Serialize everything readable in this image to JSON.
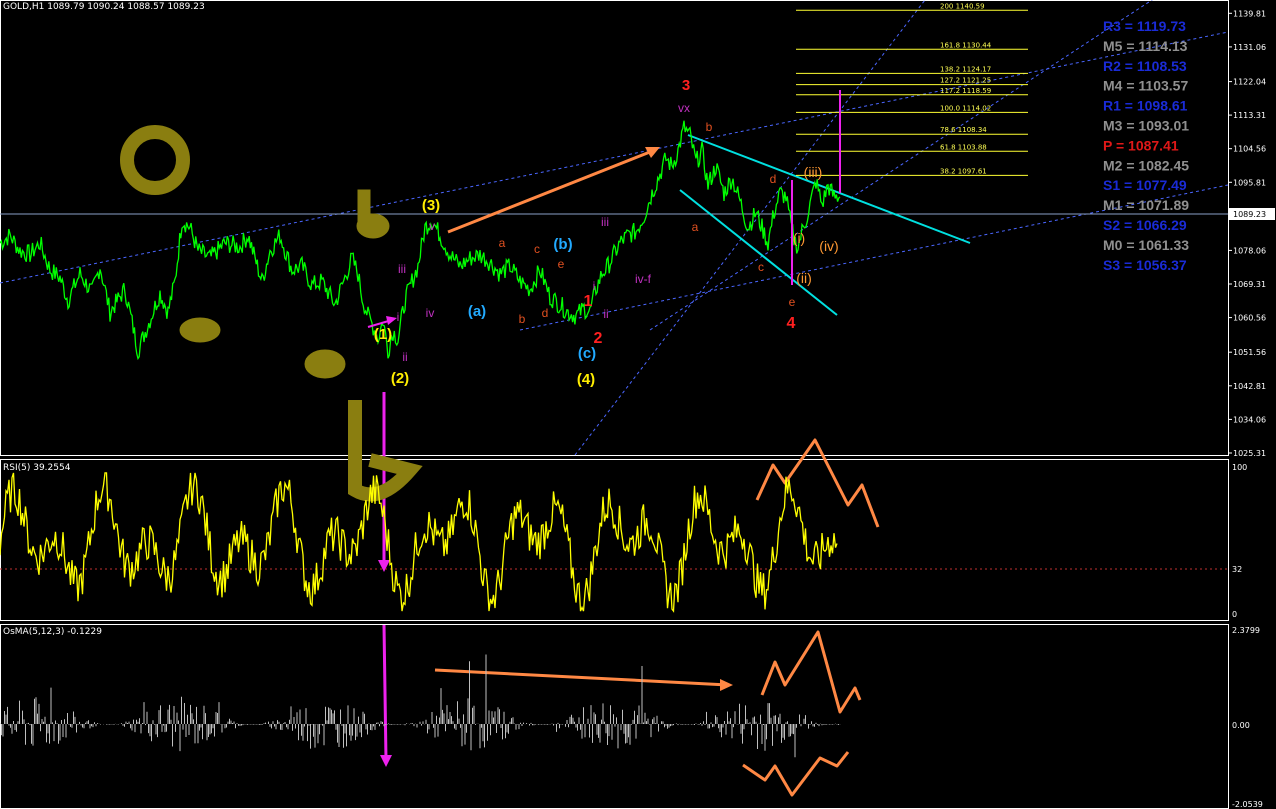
{
  "chart_data": [
    {
      "type": "line",
      "symbol_title": "GOLD,H1  1089.79 1090.24 1088.57 1089.23",
      "ylim": [
        1025.31,
        1141.2
      ],
      "y_ticks": [
        "1139.81",
        "1131.06",
        "1122.04",
        "1113.31",
        "1104.56",
        "1095.81",
        "1086.81",
        "1078.06",
        "1069.31",
        "1060.56",
        "1051.56",
        "1042.81",
        "1034.06",
        "1025.31"
      ],
      "current_price": "1089.23",
      "series_color": "#00ff00",
      "x": [
        0,
        10,
        20,
        30,
        40,
        50,
        60,
        68,
        80,
        92,
        100,
        110,
        125,
        138,
        150,
        160,
        168,
        175,
        182,
        190,
        198,
        210,
        225,
        240,
        248,
        255,
        262,
        270,
        280,
        292,
        302,
        312,
        322,
        335,
        345,
        352,
        358,
        362,
        368,
        372,
        378,
        383,
        388,
        393,
        398,
        405,
        412,
        418,
        425,
        432,
        440,
        450,
        460,
        470,
        480,
        490,
        500,
        510,
        520,
        530,
        540,
        550,
        560,
        568,
        576,
        584,
        590,
        596,
        602,
        608,
        614,
        620,
        628,
        636,
        644,
        652,
        660,
        666,
        672,
        678,
        684,
        690,
        696,
        702,
        708,
        716,
        724,
        732,
        740,
        748,
        756,
        762,
        768,
        774,
        780,
        786,
        790,
        794,
        798,
        802,
        806,
        810,
        816,
        822,
        828,
        834,
        840
      ],
      "y": [
        1080,
        1082,
        1078,
        1077,
        1080,
        1073,
        1071,
        1065,
        1072,
        1067,
        1074,
        1062,
        1068,
        1052,
        1060,
        1067,
        1062,
        1070,
        1086,
        1084,
        1078,
        1076,
        1080,
        1079,
        1082,
        1076,
        1070,
        1078,
        1082,
        1073,
        1074,
        1069,
        1070,
        1064,
        1071,
        1076,
        1072,
        1066,
        1061,
        1059,
        1055,
        1060,
        1052,
        1057,
        1055,
        1065,
        1070,
        1074,
        1084,
        1086,
        1082,
        1077,
        1074,
        1076,
        1077,
        1075,
        1072,
        1074,
        1070,
        1068,
        1073,
        1066,
        1064,
        1062,
        1061,
        1063,
        1062,
        1068,
        1072,
        1074,
        1077,
        1080,
        1082,
        1083,
        1087,
        1093,
        1098,
        1102,
        1100,
        1104,
        1110,
        1108,
        1101,
        1104,
        1095,
        1100,
        1093,
        1097,
        1091,
        1084,
        1088,
        1084,
        1080,
        1088,
        1093,
        1092,
        1086,
        1081,
        1079,
        1083,
        1086,
        1090,
        1096,
        1090,
        1095,
        1092,
        1092
      ]
    },
    {
      "type": "line",
      "title": "RSI(5) 39.2554",
      "ylim": [
        0,
        100
      ],
      "y_ticks": [
        "100",
        "32",
        "0"
      ],
      "levels": [
        32
      ],
      "series_color": "#ffff00"
    },
    {
      "type": "bar",
      "title": "OsMA(5,12,3) -0.1229",
      "ylim": [
        -2.0539,
        2.3799
      ],
      "y_ticks": [
        "2.3799",
        "0.00",
        "-2.0539"
      ],
      "series_color": "#bfbfbf"
    }
  ],
  "pivots": [
    {
      "text": "R3 = 1119.73",
      "color": "#1a2bd6"
    },
    {
      "text": "M5 = 1114.13",
      "color": "#909090"
    },
    {
      "text": "R2 = 1108.53",
      "color": "#1a2bd6"
    },
    {
      "text": "M4 = 1103.57",
      "color": "#909090"
    },
    {
      "text": "R1 = 1098.61",
      "color": "#1a2bd6"
    },
    {
      "text": "M3 = 1093.01",
      "color": "#909090"
    },
    {
      "text": "P   = 1087.41",
      "color": "#e01818"
    },
    {
      "text": "M2 = 1082.45",
      "color": "#909090"
    },
    {
      "text": "S1 = 1077.49",
      "color": "#1a2bd6"
    },
    {
      "text": "M1 = 1071.89",
      "color": "#909090"
    },
    {
      "text": "S2 = 1066.29",
      "color": "#1a2bd6"
    },
    {
      "text": "M0 = 1061.33",
      "color": "#909090"
    },
    {
      "text": "S3 = 1056.37",
      "color": "#1a2bd6"
    }
  ],
  "fib_levels": [
    {
      "label": "200  1140.59",
      "price": 1140.59
    },
    {
      "label": "161.8  1130.44",
      "price": 1130.44
    },
    {
      "label": "138.2  1124.17",
      "price": 1124.17
    },
    {
      "label": "127.2  1121.25",
      "price": 1121.25
    },
    {
      "label": "117.2  1118.59",
      "price": 1118.59
    },
    {
      "label": "100.0   1114.02",
      "price": 1114.02
    },
    {
      "label": "78.6  1108.34",
      "price": 1108.34
    },
    {
      "label": "61.8  1103.88",
      "price": 1103.88
    },
    {
      "label": "38.2  1097.61",
      "price": 1097.61
    }
  ],
  "wave_labels": [
    {
      "text": "3",
      "color": "#ff2020"
    },
    {
      "text": "vx",
      "color": "#c030c0"
    },
    {
      "text": "b",
      "color": "#e05020"
    },
    {
      "text": "a",
      "color": "#e05020"
    },
    {
      "text": "d",
      "color": "#e05020"
    },
    {
      "text": "c",
      "color": "#e05020"
    },
    {
      "text": "e",
      "color": "#e05020"
    },
    {
      "text": "4",
      "color": "#ff2020"
    },
    {
      "text": "(iii)",
      "color": "#ff9933"
    },
    {
      "text": "(i)",
      "color": "#ff9933"
    },
    {
      "text": "(ii)",
      "color": "#ff9933"
    },
    {
      "text": "(iv)",
      "color": "#ff9933"
    },
    {
      "text": "(3)",
      "color": "#ffee00"
    },
    {
      "text": "v",
      "color": "#c030c0"
    },
    {
      "text": "iii",
      "color": "#c030c0"
    },
    {
      "text": "iv",
      "color": "#c030c0"
    },
    {
      "text": "i",
      "color": "#c030c0"
    },
    {
      "text": "ii",
      "color": "#c030c0"
    },
    {
      "text": "(1)",
      "color": "#ffee00"
    },
    {
      "text": "(2)",
      "color": "#ffee00"
    },
    {
      "text": "(a)",
      "color": "#22aaff"
    },
    {
      "text": "a",
      "color": "#e05020"
    },
    {
      "text": "c",
      "color": "#e05020"
    },
    {
      "text": "(b)",
      "color": "#22aaff"
    },
    {
      "text": "e",
      "color": "#e05020"
    },
    {
      "text": "b",
      "color": "#e05020"
    },
    {
      "text": "d",
      "color": "#e05020"
    },
    {
      "text": "1",
      "color": "#ff2020"
    },
    {
      "text": "i",
      "color": "#c030c0"
    },
    {
      "text": "ii",
      "color": "#c030c0"
    },
    {
      "text": "2",
      "color": "#ff2020"
    },
    {
      "text": "(c)",
      "color": "#22aaff"
    },
    {
      "text": "(4)",
      "color": "#ffee00"
    },
    {
      "text": "iii",
      "color": "#c030c0"
    },
    {
      "text": "iv-f",
      "color": "#c030c0"
    }
  ],
  "handwriting": [
    "a",
    "b",
    "a",
    "c",
    "g"
  ]
}
